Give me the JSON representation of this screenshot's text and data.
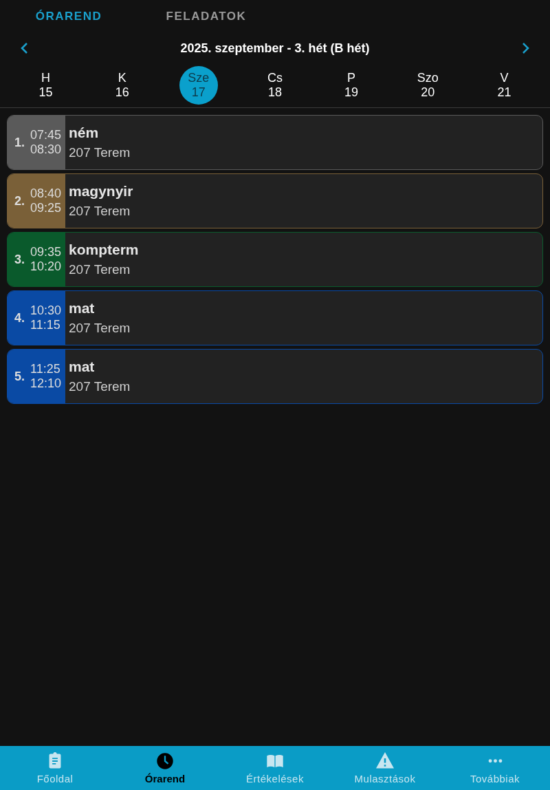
{
  "tabs": [
    {
      "label": "ÓRAREND",
      "selected": true
    },
    {
      "label": "FELADATOK",
      "selected": false
    }
  ],
  "week": {
    "title": "2025. szeptember - 3. hét (B hét)"
  },
  "days": [
    {
      "name": "H",
      "date": "15",
      "selected": false
    },
    {
      "name": "K",
      "date": "16",
      "selected": false
    },
    {
      "name": "Sze",
      "date": "17",
      "selected": true
    },
    {
      "name": "Cs",
      "date": "18",
      "selected": false
    },
    {
      "name": "P",
      "date": "19",
      "selected": false
    },
    {
      "name": "Szo",
      "date": "20",
      "selected": false
    },
    {
      "name": "V",
      "date": "21",
      "selected": false
    }
  ],
  "lessons": [
    {
      "number": "1.",
      "start": "07:45",
      "end": "08:30",
      "subject": "ném",
      "room": "207 Terem",
      "color": "#5a5a5a"
    },
    {
      "number": "2.",
      "start": "08:40",
      "end": "09:25",
      "subject": "magynyir",
      "room": "207 Terem",
      "color": "#7a6038"
    },
    {
      "number": "3.",
      "start": "09:35",
      "end": "10:20",
      "subject": "kompterm",
      "room": "207 Terem",
      "color": "#0a5a2c"
    },
    {
      "number": "4.",
      "start": "10:30",
      "end": "11:15",
      "subject": "mat",
      "room": "207 Terem",
      "color": "#0a4aa4"
    },
    {
      "number": "5.",
      "start": "11:25",
      "end": "12:10",
      "subject": "mat",
      "room": "207 Terem",
      "color": "#0a4aa4"
    }
  ],
  "bottom_nav": [
    {
      "label": "Főoldal",
      "kind": "clipboard",
      "selected": false
    },
    {
      "label": "Órarend",
      "kind": "clock",
      "selected": true
    },
    {
      "label": "Értékelések",
      "kind": "book",
      "selected": false
    },
    {
      "label": "Mulasztások",
      "kind": "warning",
      "selected": false
    },
    {
      "label": "Továbbiak",
      "kind": "more",
      "selected": false
    }
  ]
}
